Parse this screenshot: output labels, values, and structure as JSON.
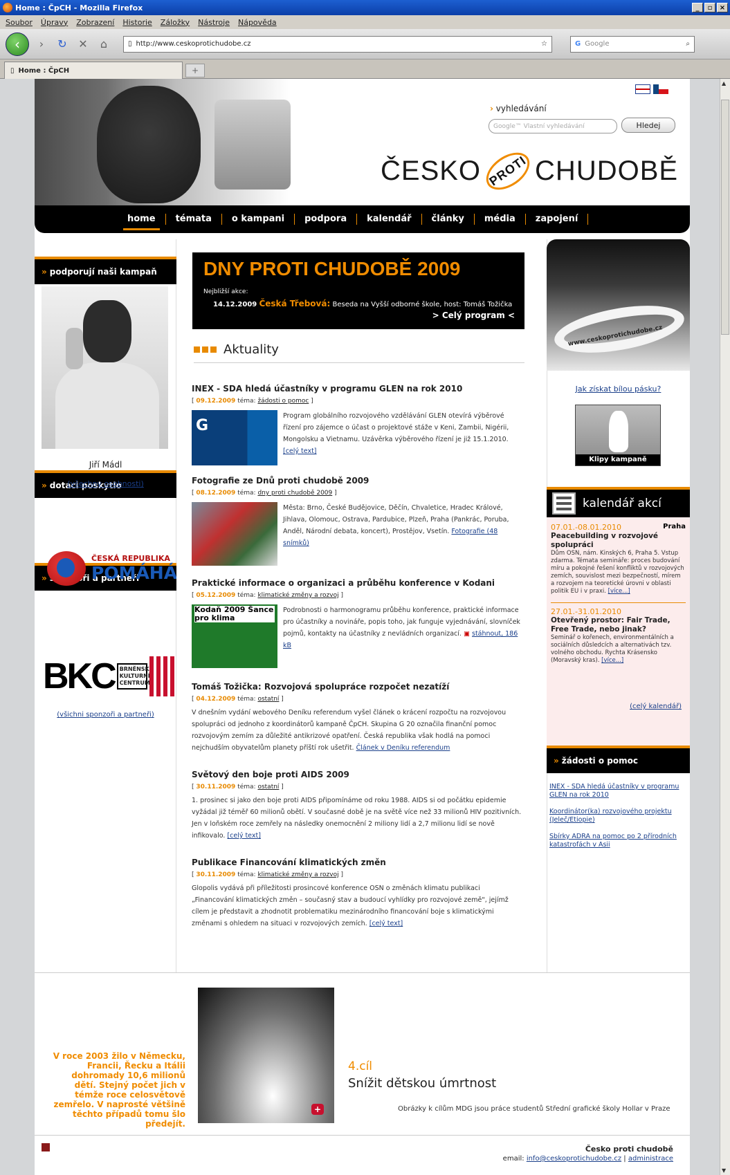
{
  "window": {
    "title": "Home : ČpCH - Mozilla Firefox",
    "controls": [
      "_",
      "▫",
      "×"
    ]
  },
  "menu": [
    "Soubor",
    "Úpravy",
    "Zobrazení",
    "Historie",
    "Záložky",
    "Nástroje",
    "Nápověda"
  ],
  "nav": {
    "url": "http://www.ceskoprotichudobe.cz",
    "search_placeholder": "Google"
  },
  "tab": {
    "label": "Home : ČpCH"
  },
  "header": {
    "search_label": "vyhledávání",
    "search_placeholder": "Google™ Vlastní vyhledávání",
    "search_button": "Hledej",
    "logo_left": "ČESKO",
    "logo_mid": "PROTI",
    "logo_right": "CHUDOBĚ"
  },
  "topnav": [
    "home",
    "témata",
    "o kampani",
    "podpora",
    "kalendář",
    "články",
    "média",
    "zapojení"
  ],
  "left": {
    "support_head": "podporují naši kampaň",
    "person_name": "Jiří Mádl",
    "person_link": "(všechny osobnosti)",
    "grant_head": "dotaci poskytlo",
    "pomaha_top": "ČESKÁ REPUBLIKA",
    "pomaha_big": "POMÁHÁ",
    "sponsors_head": "sponzoři a partneři",
    "bkc_letters": "BKC",
    "bkc_text": "BRNĚNSKÉ KULTURNÍ CENTRUM",
    "sponsors_link": "(všichni sponzoři a partneři)"
  },
  "banner": {
    "title": "DNY PROTI CHUDOBĚ 2009",
    "sub": "Nejbližší akce:",
    "date": "14.12.2009",
    "city": "Česká Třebová:",
    "text": "Beseda na Vyšší odborné škole, host: Tomáš Tožička",
    "program": "> Celý program <"
  },
  "aktuality_title": "Aktuality",
  "articles": [
    {
      "title": "INEX - SDA hledá účastníky v programu GLEN na rok 2010",
      "date": "09.12.2009",
      "tema_label": "téma:",
      "tema": "žádosti o pomoc",
      "text": "Program globálního rozvojového vzdělávání GLEN otevírá výběrové řízení pro zájemce o účast o projektové stáže v Keni, Zambii, Nigérii, Mongolsku a Vietnamu. Uzávěrka výběrového řízení je již 15.1.2010.",
      "more": "[celý text]"
    },
    {
      "title": "Fotografie ze Dnů proti chudobě 2009",
      "date": "08.12.2009",
      "tema_label": "téma:",
      "tema": "dny proti chudobě 2009",
      "text": "Města: Brno, České Budějovice, Děčín, Chvaletice, Hradec Králové, Jihlava, Olomouc, Ostrava, Pardubice, Plzeň, Praha (Pankrác, Poruba, Anděl, Národní debata, koncert), Prostějov, Vsetín.",
      "more": "Fotografie (48 snímků)"
    },
    {
      "title": "Praktické informace o organizaci a průběhu konference v Kodani",
      "date": "05.12.2009",
      "tema_label": "téma:",
      "tema": "klimatické změny a rozvoj",
      "text": "Podrobnosti o harmonogramu průběhu konference, praktické informace pro účastníky a novináře, popis toho, jak funguje vyjednávání, slovníček pojmů, kontakty na účastníky z nevládních organizací.",
      "more": "stáhnout, 186 kB",
      "thumb_text": "Kodaň 2009 Šance pro klima"
    },
    {
      "title": "Tomáš Tožička: Rozvojová spolupráce rozpočet nezatíží",
      "date": "04.12.2009",
      "tema_label": "téma:",
      "tema": "ostatní",
      "text": "V dnešním vydání webového Deníku referendum vyšel článek o krácení rozpočtu na rozvojovou spolupráci od jednoho z koordinátorů kampaně ČpCH. Skupina G 20 označila finanční pomoc rozvojovým zemím za důležité antikrizové opatření. Česká republika však hodlá na pomoci nejchudším obyvatelům planety příští rok ušetřit.",
      "more": "Článek v Deníku referendum"
    },
    {
      "title": "Světový den boje proti AIDS 2009",
      "date": "30.11.2009",
      "tema_label": "téma:",
      "tema": "ostatní",
      "text": "1. prosinec si jako den boje proti AIDS připomínáme od roku 1988. AIDS si od počátku epidemie vyžádal již téměř 60 milionů obětí. V současné době je na světě více než 33 milionů HIV pozitivních. Jen v loňském roce zemřely na následky onemocnění 2 miliony lidí a 2,7 milionu lidí se nově infikovalo.",
      "more": "[celý text]"
    },
    {
      "title": "Publikace Financování klimatických změn",
      "date": "30.11.2009",
      "tema_label": "téma:",
      "tema": "klimatické změny a rozvoj",
      "text": "Glopolis vydává při příležitosti prosincové konference OSN o změnách klimatu publikaci „Financování klimatických změn – současný stav a budoucí vyhlídky pro rozvojové země\", jejímž cílem je představit a zhodnotit problematiku mezinárodního financování boje s klimatickými změnami s ohledem na situaci v rozvojových zemích.",
      "more": "[celý text]"
    }
  ],
  "right": {
    "pasek_label": "www.ceskoprotichudobe.cz",
    "pasek_link": "Jak získat bílou pásku?",
    "klipy": "Klipy kampaně",
    "kal_head": "kalendář akcí",
    "events": [
      {
        "date": "07.01.-08.01.2010",
        "place": "Praha",
        "name": "Peacebuilding v rozvojové spolupráci",
        "desc": "Dům OSN, nám. Kinských 6, Praha 5. Vstup zdarma. Témata semináře: proces budování míru a pokojné řešení konfliktů v rozvojových zemích, souvislost mezi bezpečností, mírem a rozvojem na teoretické úrovni v oblasti politik EU i v praxi.",
        "more": "[více...]"
      },
      {
        "date": "27.01.-31.01.2010",
        "place": "",
        "name": "Otevřený prostor: Fair Trade, Free Trade, nebo jinak?",
        "desc": "Seminář o kořenech, environmentálních a sociálních důsledcích a alternativách tzv. volného obchodu. Rychta Krásensko (Moravský kras).",
        "more": "[více...]"
      }
    ],
    "kal_all": "(celý kalendář)",
    "zad_head": "žádosti o pomoc",
    "zad_links": [
      "INEX - SDA hledá účastníky v programu GLEN na rok 2010",
      "Koordinátor(ka) rozvojového projektu (Jeleč/Etiopie)",
      "Sbírky ADRA na pomoc po 2 přírodních katastrofách v Asii"
    ]
  },
  "promo": {
    "text": "V roce 2003 žilo v Německu, Francii, Řecku a Itálii dohromady 10,6 milionů dětí. Stejný počet jich v témže roce celosvětově zemřelo. V naprosté většině těchto případů tomu šlo předejít.",
    "goal_num": "4.cíl",
    "goal_title": "Snížit dětskou úmrtnost",
    "note": "Obrázky k cílům MDG jsou práce studentů Střední grafické školy Hollar v Praze"
  },
  "footer": {
    "org": "Česko proti chudobě",
    "email_label": "email:",
    "email": "info@ceskoprotichudobe.cz",
    "sep": "|",
    "admin": "administrace"
  },
  "colors": {
    "accent": "#e88a00",
    "nav_bg": "#000000",
    "link": "#1a3f8a"
  }
}
